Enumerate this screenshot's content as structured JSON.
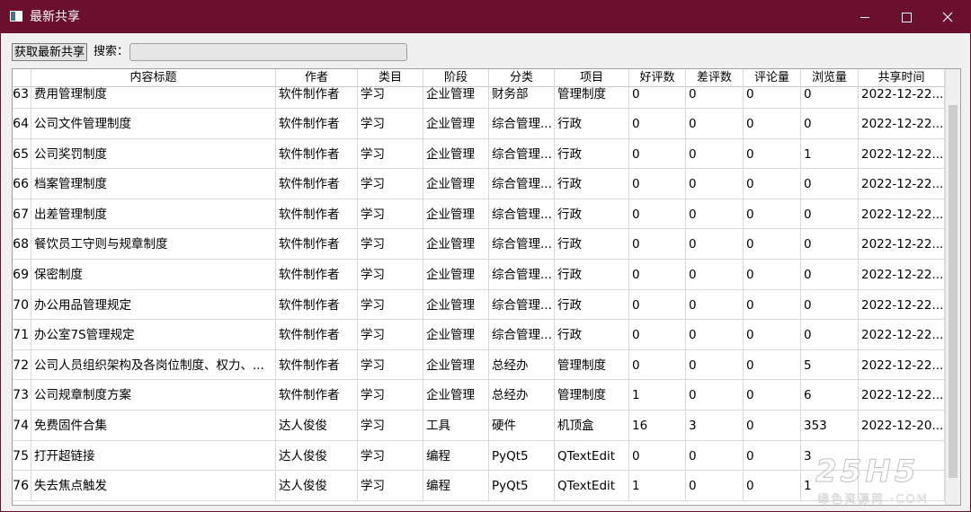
{
  "window": {
    "title": "最新共享"
  },
  "toolbar": {
    "fetch_label": "获取最新共享",
    "search_label": "搜索：",
    "search_value": ""
  },
  "table": {
    "columns": [
      "内容标题",
      "作者",
      "类目",
      "阶段",
      "分类",
      "项目",
      "好评数",
      "差评数",
      "评论量",
      "浏览量",
      "共享时间"
    ],
    "rows": [
      {
        "num": "63",
        "cells": [
          "费用管理制度",
          "软件制作者",
          "学习",
          "企业管理",
          "财务部",
          "管理制度",
          "0",
          "0",
          "0",
          "0",
          "2022-12-22..."
        ]
      },
      {
        "num": "64",
        "cells": [
          "公司文件管理制度",
          "软件制作者",
          "学习",
          "企业管理",
          "综合管理...",
          "行政",
          "0",
          "0",
          "0",
          "0",
          "2022-12-22..."
        ]
      },
      {
        "num": "65",
        "cells": [
          "公司奖罚制度",
          "软件制作者",
          "学习",
          "企业管理",
          "综合管理...",
          "行政",
          "0",
          "0",
          "0",
          "1",
          "2022-12-22..."
        ]
      },
      {
        "num": "66",
        "cells": [
          "档案管理制度",
          "软件制作者",
          "学习",
          "企业管理",
          "综合管理...",
          "行政",
          "0",
          "0",
          "0",
          "0",
          "2022-12-22..."
        ]
      },
      {
        "num": "67",
        "cells": [
          "出差管理制度",
          "软件制作者",
          "学习",
          "企业管理",
          "综合管理...",
          "行政",
          "0",
          "0",
          "0",
          "0",
          "2022-12-22..."
        ]
      },
      {
        "num": "68",
        "cells": [
          "餐饮员工守则与规章制度",
          "软件制作者",
          "学习",
          "企业管理",
          "综合管理...",
          "行政",
          "0",
          "0",
          "0",
          "0",
          "2022-12-22..."
        ]
      },
      {
        "num": "69",
        "cells": [
          "保密制度",
          "软件制作者",
          "学习",
          "企业管理",
          "综合管理...",
          "行政",
          "0",
          "0",
          "0",
          "0",
          "2022-12-22..."
        ]
      },
      {
        "num": "70",
        "cells": [
          "办公用品管理规定",
          "软件制作者",
          "学习",
          "企业管理",
          "综合管理...",
          "行政",
          "0",
          "0",
          "0",
          "0",
          "2022-12-22..."
        ]
      },
      {
        "num": "71",
        "cells": [
          "办公室7S管理规定",
          "软件制作者",
          "学习",
          "企业管理",
          "综合管理...",
          "行政",
          "0",
          "0",
          "0",
          "0",
          "2022-12-22..."
        ]
      },
      {
        "num": "72",
        "cells": [
          "公司人员组织架构及各岗位制度、权力、...",
          "软件制作者",
          "学习",
          "企业管理",
          "总经办",
          "管理制度",
          "0",
          "0",
          "0",
          "5",
          "2022-12-22..."
        ]
      },
      {
        "num": "73",
        "cells": [
          "公司规章制度方案",
          "软件制作者",
          "学习",
          "企业管理",
          "总经办",
          "管理制度",
          "1",
          "0",
          "0",
          "6",
          "2022-12-22..."
        ]
      },
      {
        "num": "74",
        "cells": [
          "免费固件合集",
          "达人俊俊",
          "学习",
          "工具",
          "硬件",
          "机顶盒",
          "16",
          "3",
          "0",
          "353",
          "2022-12-20..."
        ]
      },
      {
        "num": "75",
        "cells": [
          "打开超链接",
          "达人俊俊",
          "学习",
          "编程",
          "PyQt5",
          "QTextEdit",
          "0",
          "0",
          "0",
          "3",
          ""
        ]
      },
      {
        "num": "76",
        "cells": [
          "失去焦点触发",
          "达人俊俊",
          "学习",
          "编程",
          "PyQt5",
          "QTextEdit",
          "1",
          "0",
          "0",
          "1",
          ""
        ]
      }
    ]
  },
  "watermark": {
    "big": "25H5",
    "small": "绿色资源网 ·COM"
  }
}
